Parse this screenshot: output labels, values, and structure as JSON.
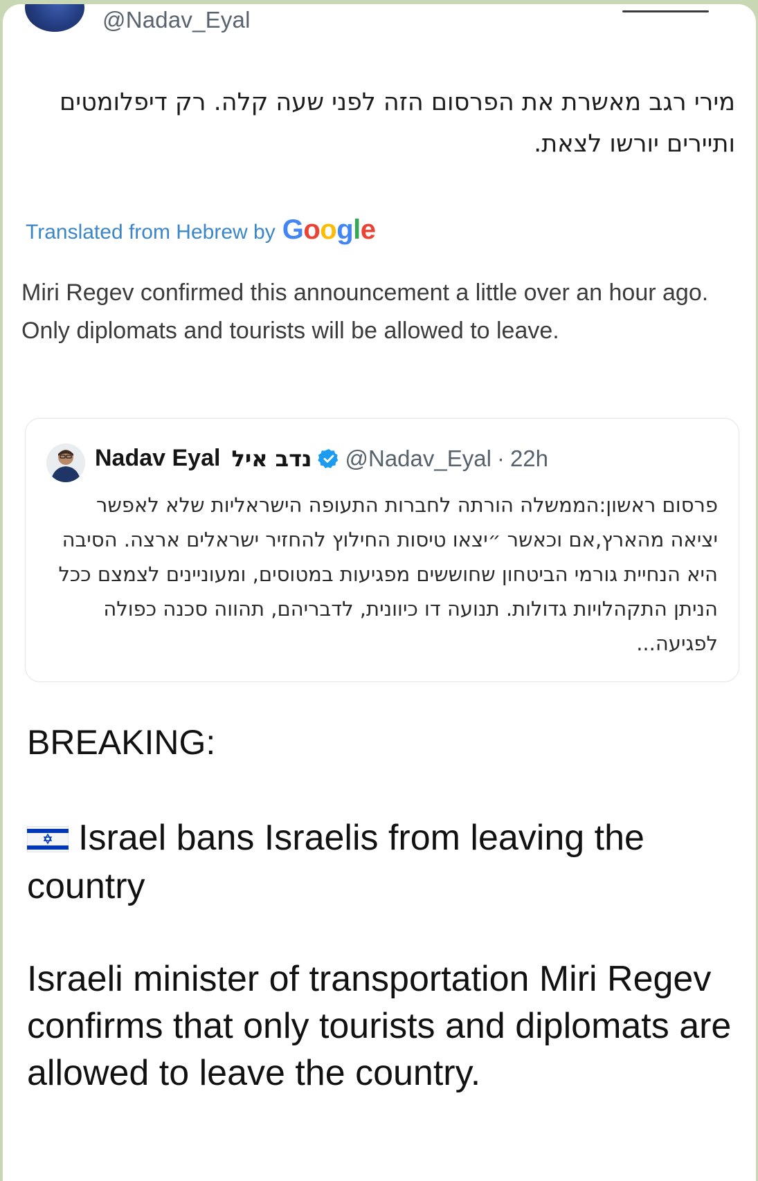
{
  "tweet": {
    "handle": "@Nadav_Eyal",
    "hebrew_text": "מירי רגב מאשרת את הפרסום הזה לפני שעה קלה. רק דיפלומטים ותיירים יורשו לצאת.",
    "translated_label": "Translated from Hebrew by",
    "translation_provider": "Google",
    "translation": "Miri Regev confirmed this announcement a little over an hour ago. Only diplomats and tourists will be allowed to leave."
  },
  "quoted_tweet": {
    "name": "Nadav Eyal",
    "hebrew_name": "נדב איל",
    "handle": "@Nadav_Eyal",
    "separator": "·",
    "time": "22h",
    "body": "פרסום ראשון:הממשלה הורתה לחברות התעופה הישראליות שלא לאפשר יציאה מהארץ,אם וכאשר ״יצאו טיסות החילוץ להחזיר ישראלים ארצה. הסיבה היא הנחיית גורמי הביטחון שחוששים מפגיעות במטוסים, ומעוניינים לצמצם ככל הניתן התקהלויות גדולות. תנועה דו כיוונית, לדבריהם, תהווה סכנה כפולה לפגיעה..."
  },
  "post": {
    "breaking": "BREAKING:",
    "headline": "Israel bans Israelis from leaving the country",
    "story": "Israeli minister of transportation Miri Regev confirms that only tourists and diplomats are allowed to leave the country."
  },
  "icons": {
    "verified": "verified-badge-icon",
    "flag": "israel-flag-icon"
  },
  "colors": {
    "link_blue": "#3a86c8",
    "verified_blue": "#1d9bf0",
    "flag_blue": "#0038b8",
    "background_green": "#c9d8b4"
  }
}
